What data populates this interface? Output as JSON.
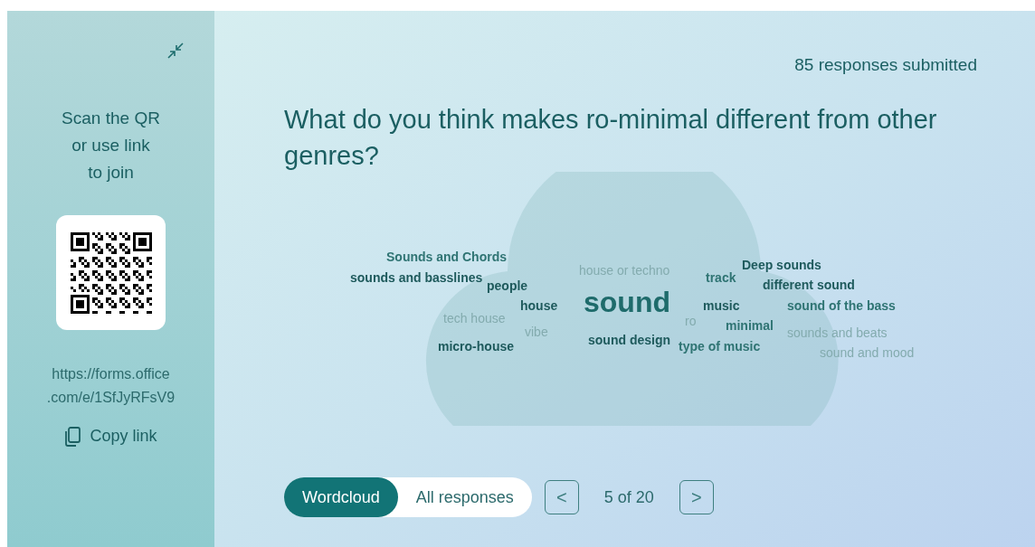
{
  "sidebar": {
    "instructions": "Scan the QR\nor use link\nto join",
    "link": "https://forms.office\n.com/e/1SfJyRFsV9",
    "copy_button": "Copy link"
  },
  "responses_count": "85 responses submitted",
  "question": "What do you think makes ro-minimal different from other genres?",
  "wordcloud": [
    {
      "text": "Sounds and Chords",
      "kind": "medium"
    },
    {
      "text": "sounds and basslines",
      "kind": "high"
    },
    {
      "text": "people",
      "kind": "high"
    },
    {
      "text": "house",
      "kind": "high"
    },
    {
      "text": "tech house",
      "kind": "low"
    },
    {
      "text": "vibe",
      "kind": "low"
    },
    {
      "text": "micro-house",
      "kind": "high"
    },
    {
      "text": "house or techno",
      "kind": "low"
    },
    {
      "text": "sound",
      "kind": "top"
    },
    {
      "text": "ro",
      "kind": "low"
    },
    {
      "text": "sound design",
      "kind": "high"
    },
    {
      "text": "track",
      "kind": "medium"
    },
    {
      "text": "Deep sounds",
      "kind": "high"
    },
    {
      "text": "different sound",
      "kind": "high"
    },
    {
      "text": "music",
      "kind": "high"
    },
    {
      "text": "sound of the bass",
      "kind": "medium"
    },
    {
      "text": "minimal",
      "kind": "medium"
    },
    {
      "text": "sounds and beats",
      "kind": "low"
    },
    {
      "text": "type of music",
      "kind": "medium"
    },
    {
      "text": "sound and mood",
      "kind": "low"
    }
  ],
  "view_tabs": [
    {
      "label": "Wordcloud",
      "selected": true
    },
    {
      "label": "All responses",
      "selected": false
    }
  ],
  "pager": {
    "label": "5 of 20",
    "prev": "<",
    "next": ">"
  }
}
